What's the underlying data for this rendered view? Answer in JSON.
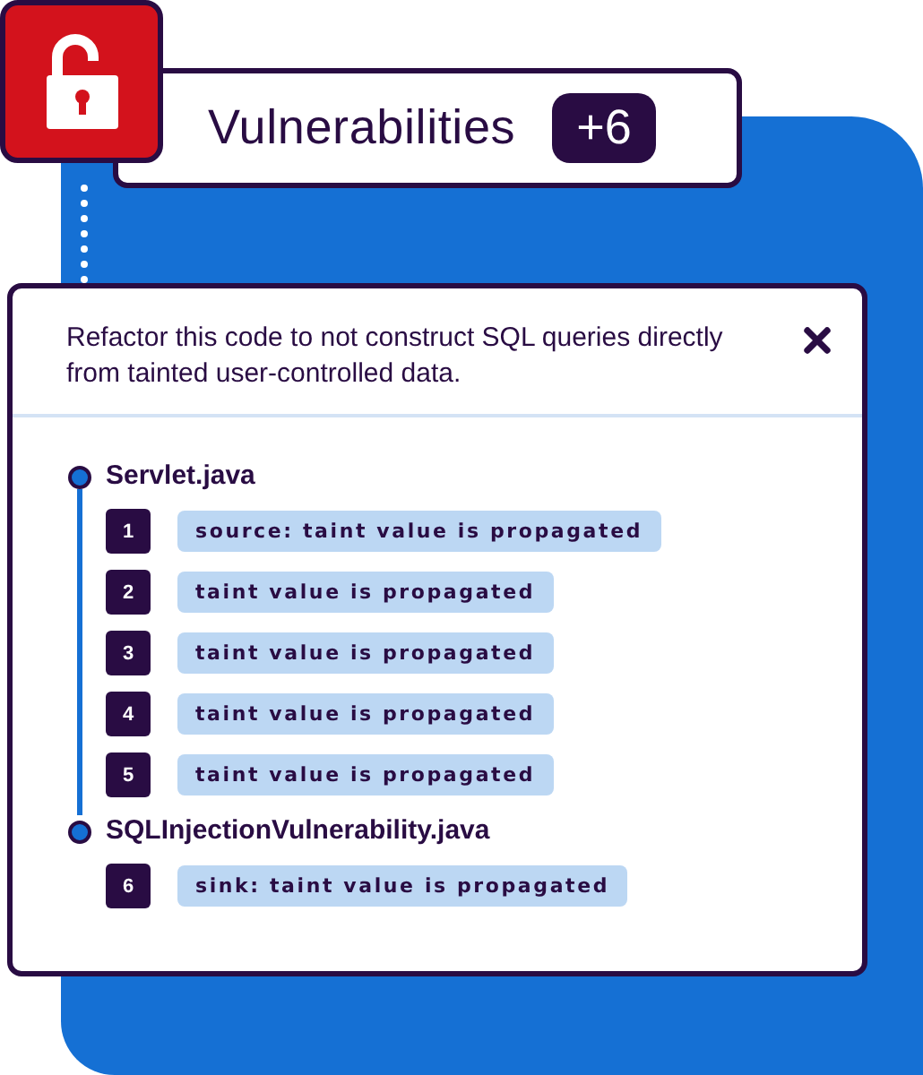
{
  "header": {
    "title": "Vulnerabilities",
    "count": "+6"
  },
  "issue": {
    "message": "Refactor this code to not construct SQL queries directly from tainted user-controlled data."
  },
  "files": [
    {
      "name": "Servlet.java",
      "steps": [
        {
          "number": "1",
          "label": "source: taint value is propagated"
        },
        {
          "number": "2",
          "label": "taint value is propagated"
        },
        {
          "number": "3",
          "label": "taint value is propagated"
        },
        {
          "number": "4",
          "label": "taint value is propagated"
        },
        {
          "number": "5",
          "label": "taint value is propagated"
        }
      ]
    },
    {
      "name": "SQLInjectionVulnerability.java",
      "steps": [
        {
          "number": "6",
          "label": "sink: taint value is propagated"
        }
      ]
    }
  ]
}
